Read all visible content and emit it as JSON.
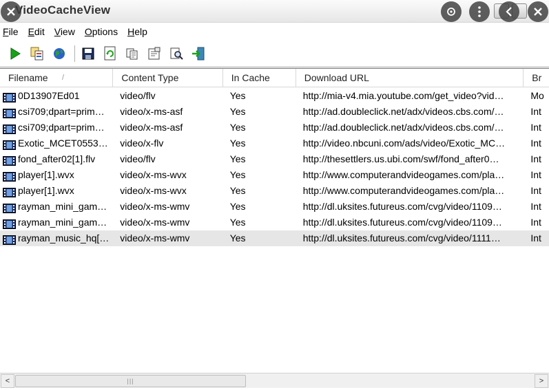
{
  "window": {
    "title": "VideoCacheView"
  },
  "menu": [
    "File",
    "Edit",
    "View",
    "Options",
    "Help"
  ],
  "toolbar_icons": [
    "play-icon",
    "copy-files-icon",
    "web-icon",
    "save-icon",
    "refresh-icon",
    "copy-icon",
    "properties-icon",
    "find-icon",
    "exit-icon"
  ],
  "table": {
    "columns": [
      "Filename",
      "Content Type",
      "In Cache",
      "Download URL",
      "Br"
    ],
    "rows": [
      [
        "0D13907Ed01",
        "video/flv",
        "Yes",
        "http://mia-v4.mia.youtube.com/get_video?vid…",
        "Mo"
      ],
      [
        "csi709;dpart=prim…",
        "video/x-ms-asf",
        "Yes",
        "http://ad.doubleclick.net/adx/videos.cbs.com/…",
        "Int"
      ],
      [
        "csi709;dpart=prim…",
        "video/x-ms-asf",
        "Yes",
        "http://ad.doubleclick.net/adx/videos.cbs.com/…",
        "Int"
      ],
      [
        "Exotic_MCET0553…",
        "video/x-flv",
        "Yes",
        "http://video.nbcuni.com/ads/video/Exotic_MC…",
        "Int"
      ],
      [
        "fond_after02[1].flv",
        "video/flv",
        "Yes",
        "http://thesettlers.us.ubi.com/swf/fond_after0…",
        "Int"
      ],
      [
        "player[1].wvx",
        "video/x-ms-wvx",
        "Yes",
        "http://www.computerandvideogames.com/pla…",
        "Int"
      ],
      [
        "player[1].wvx",
        "video/x-ms-wvx",
        "Yes",
        "http://www.computerandvideogames.com/pla…",
        "Int"
      ],
      [
        "rayman_mini_gam…",
        "video/x-ms-wmv",
        "Yes",
        "http://dl.uksites.futureus.com/cvg/video/1109…",
        "Int"
      ],
      [
        "rayman_mini_gam…",
        "video/x-ms-wmv",
        "Yes",
        "http://dl.uksites.futureus.com/cvg/video/1109…",
        "Int"
      ],
      [
        "rayman_music_hq[…",
        "video/x-ms-wmv",
        "Yes",
        "http://dl.uksites.futureus.com/cvg/video/1111…",
        "Int"
      ]
    ],
    "selected_row": 9
  },
  "scrollbar": {
    "left_arrow": "<",
    "right_arrow": ">",
    "grip": "|||"
  },
  "colors": {
    "selected_row": "#e6e6e6",
    "overlay": "#3c3c3c",
    "play_green": "#1aa11a"
  }
}
